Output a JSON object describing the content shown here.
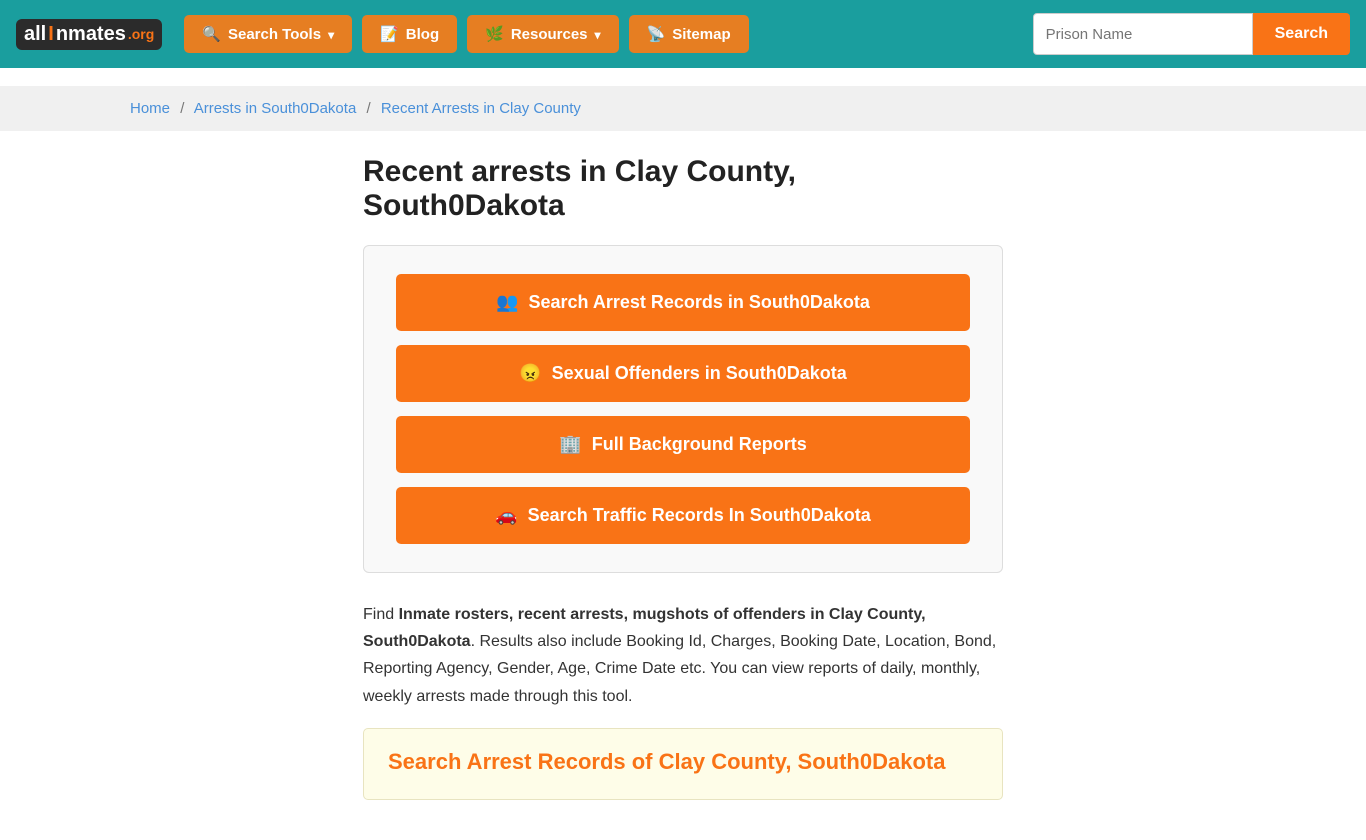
{
  "navbar": {
    "logo": {
      "all": "all",
      "i": "I",
      "nmates": "nmates",
      "org": ".org"
    },
    "search_tools_label": "Search Tools",
    "blog_label": "Blog",
    "resources_label": "Resources",
    "sitemap_label": "Sitemap",
    "prison_input_placeholder": "Prison Name",
    "search_btn_label": "Search"
  },
  "breadcrumb": {
    "home": "Home",
    "arrests": "Arrests in South0Dakota",
    "current": "Recent Arrests in Clay County"
  },
  "page": {
    "title": "Recent arrests in Clay County, South0Dakota",
    "btn1": "Search Arrest Records in South0Dakota",
    "btn2": "Sexual Offenders in South0Dakota",
    "btn3": "Full Background Reports",
    "btn4": "Search Traffic Records In South0Dakota",
    "description_prefix": "Find ",
    "description_bold1": "Inmate rosters, recent arrests, mugshots of offenders in Clay County,",
    "description_bold2": "South0Dakota",
    "description_suffix": ". Results also include Booking Id, Charges, Booking Date, Location, Bond, Reporting Agency, Gender, Age, Crime Date etc. You can view reports of daily, monthly, weekly arrests made through this tool.",
    "search_section_title": "Search Arrest Records of Clay County, South0Dakota"
  }
}
